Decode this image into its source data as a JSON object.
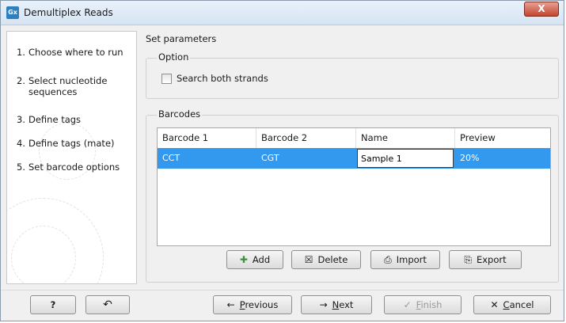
{
  "window": {
    "title": "Demultiplex Reads",
    "app_icon_text": "Gx",
    "close_glyph": "X"
  },
  "steps": [
    {
      "num": "1.",
      "label": "Choose where to run"
    },
    {
      "num": "2.",
      "label": "Select nucleotide sequences"
    },
    {
      "num": "3.",
      "label": "Define tags"
    },
    {
      "num": "4.",
      "label": "Define tags (mate)"
    },
    {
      "num": "5.",
      "label": "Set barcode options"
    }
  ],
  "main": {
    "section_title": "Set parameters",
    "option_group": {
      "title": "Option",
      "checkbox_label": "Search both strands",
      "checked": false
    },
    "barcodes_group": {
      "title": "Barcodes",
      "columns": [
        "Barcode 1",
        "Barcode 2",
        "Name",
        "Preview"
      ],
      "rows": [
        {
          "barcode1": "CCT",
          "barcode2": "CGT",
          "name": "Sample 1",
          "preview": "20%"
        }
      ]
    },
    "actions": {
      "add": "Add",
      "delete": "Delete",
      "import": "Import",
      "export": "Export"
    }
  },
  "footer": {
    "help": "?",
    "reset_icon": "reset-icon",
    "previous": {
      "pre": "",
      "key": "P",
      "post": "revious"
    },
    "next": {
      "pre": "",
      "key": "N",
      "post": "ext"
    },
    "finish": {
      "pre": "",
      "key": "F",
      "post": "inish"
    },
    "cancel": {
      "pre": "",
      "key": "C",
      "post": "ancel"
    }
  },
  "colors": {
    "selection": "#3399ee",
    "title_bar": "#d6e4f3",
    "close": "#c5432e"
  }
}
